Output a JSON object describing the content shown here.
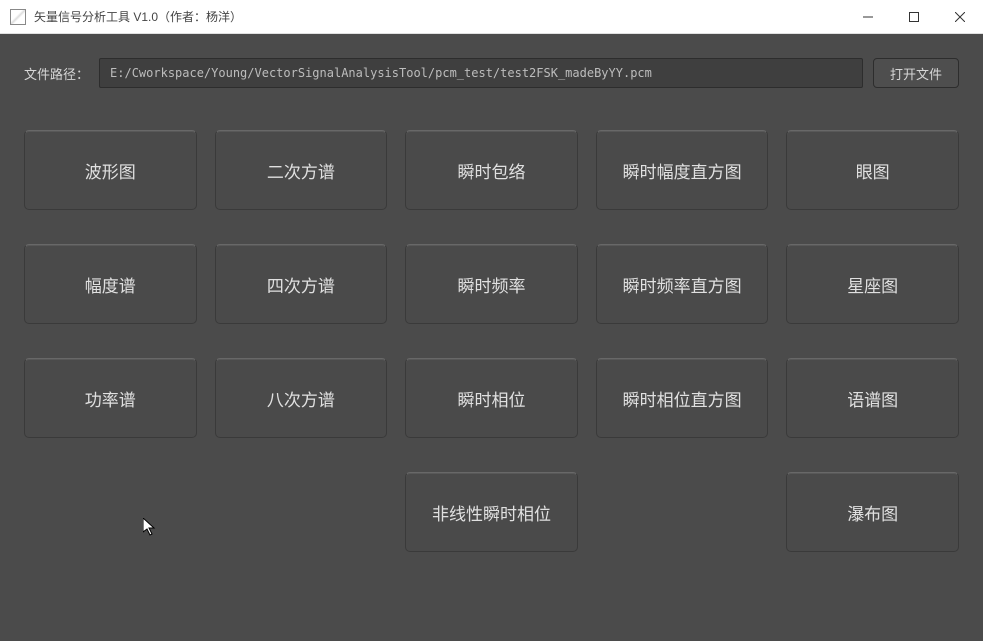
{
  "window": {
    "title": "矢量信号分析工具 V1.0（作者：杨洋）"
  },
  "file": {
    "label": "文件路径：",
    "path": "E:/Cworkspace/Young/VectorSignalAnalysisTool/pcm_test/test2FSK_madeByYY.pcm",
    "open_button": "打开文件"
  },
  "buttons": {
    "r0c0": "波形图",
    "r0c1": "二次方谱",
    "r0c2": "瞬时包络",
    "r0c3": "瞬时幅度直方图",
    "r0c4": "眼图",
    "r1c0": "幅度谱",
    "r1c1": "四次方谱",
    "r1c2": "瞬时频率",
    "r1c3": "瞬时频率直方图",
    "r1c4": "星座图",
    "r2c0": "功率谱",
    "r2c1": "八次方谱",
    "r2c2": "瞬时相位",
    "r2c3": "瞬时相位直方图",
    "r2c4": "语谱图",
    "r3c2": "非线性瞬时相位",
    "r3c4": "瀑布图"
  }
}
